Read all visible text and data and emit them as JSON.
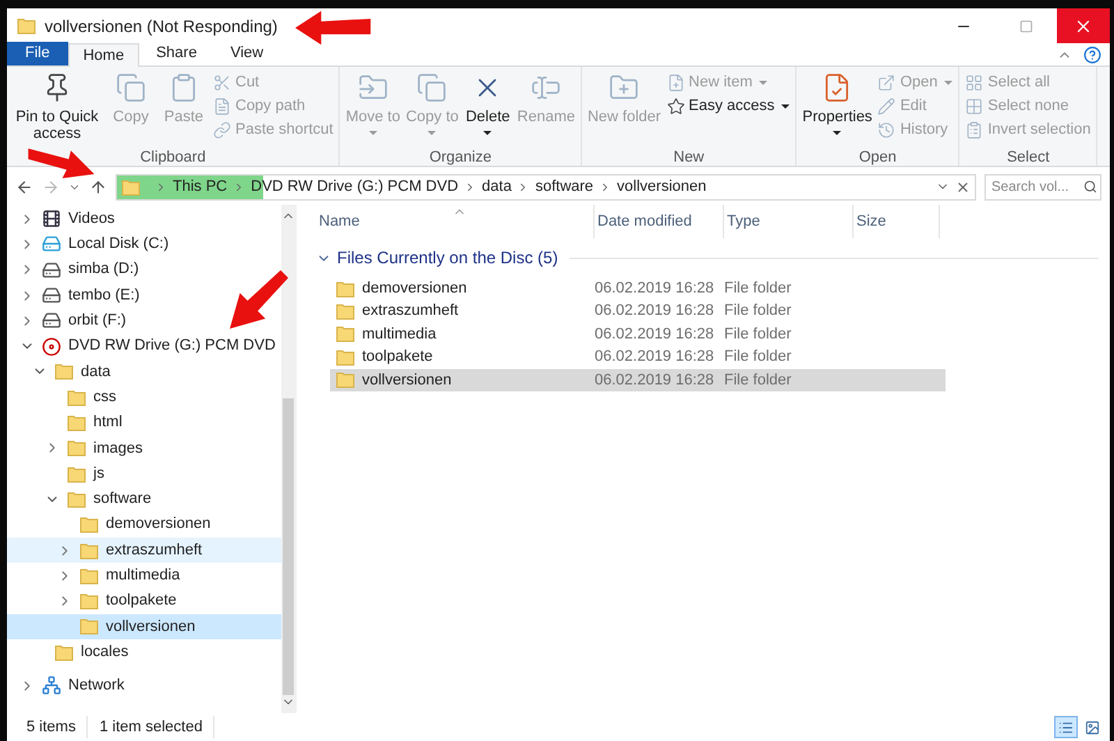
{
  "window": {
    "title": "vollversionen (Not Responding)"
  },
  "tabs": [
    {
      "label": "File",
      "kind": "file",
      "selected": false
    },
    {
      "label": "Home",
      "kind": "tab",
      "selected": true
    },
    {
      "label": "Share",
      "kind": "tab",
      "selected": false
    },
    {
      "label": "View",
      "kind": "tab",
      "selected": false
    }
  ],
  "ribbon": [
    {
      "label": "Clipboard",
      "large": [
        {
          "label": "Pin to Quick access",
          "kind": "pin",
          "disabled": false
        },
        {
          "label": "Copy",
          "kind": "copy",
          "disabled": true
        },
        {
          "label": "Paste",
          "kind": "paste",
          "disabled": true
        }
      ],
      "small": [
        {
          "label": "Cut",
          "kind": "cut",
          "disabled": true
        },
        {
          "label": "Copy path",
          "kind": "path",
          "disabled": true
        },
        {
          "label": "Paste shortcut",
          "kind": "shortcut",
          "disabled": true
        }
      ]
    },
    {
      "label": "Organize",
      "large": [
        {
          "label": "Move to",
          "kind": "move",
          "disabled": true,
          "dropdown": true
        },
        {
          "label": "Copy to",
          "kind": "copyto",
          "disabled": true,
          "dropdown": true
        },
        {
          "label": "Delete",
          "kind": "delete",
          "disabled": false,
          "dropdown": true
        },
        {
          "label": "Rename",
          "kind": "rename",
          "disabled": true
        }
      ]
    },
    {
      "label": "New",
      "large": [
        {
          "label": "New folder",
          "kind": "newfolder",
          "disabled": true
        }
      ],
      "small": [
        {
          "label": "New item",
          "kind": "newitem",
          "disabled": true,
          "dropdown": true
        },
        {
          "label": "Easy access",
          "kind": "easy",
          "disabled": false,
          "dropdown": true
        }
      ]
    },
    {
      "label": "Open",
      "large": [
        {
          "label": "Properties",
          "kind": "properties",
          "disabled": false,
          "dropdown": true
        }
      ],
      "small": [
        {
          "label": "Open",
          "kind": "open",
          "disabled": true,
          "dropdown": true
        },
        {
          "label": "Edit",
          "kind": "edit",
          "disabled": true
        },
        {
          "label": "History",
          "kind": "history",
          "disabled": true
        }
      ]
    },
    {
      "label": "Select",
      "small": [
        {
          "label": "Select all",
          "kind": "selall",
          "disabled": true
        },
        {
          "label": "Select none",
          "kind": "selnone",
          "disabled": true
        },
        {
          "label": "Invert selection",
          "kind": "invert",
          "disabled": true
        }
      ]
    }
  ],
  "address_bar": {
    "level": 0.17,
    "crumbs": [
      "This PC",
      "DVD RW Drive (G:) PCM DVD",
      "data",
      "software",
      "vollversionen"
    ]
  },
  "search": {
    "placeholder": "Search vol..."
  },
  "nav_tree": [
    {
      "label": "Videos",
      "kind": "videos",
      "expanded": false
    },
    {
      "label": "Local Disk (C:)",
      "kind": "disk",
      "expanded": false
    },
    {
      "label": "simba (D:)",
      "kind": "drive",
      "expanded": false
    },
    {
      "label": "tembo (E:)",
      "kind": "drive",
      "expanded": false
    },
    {
      "label": "orbit (F:)",
      "kind": "drive",
      "expanded": false
    },
    {
      "label": "DVD RW Drive (G:) PCM DVD",
      "kind": "dvd",
      "expanded": true,
      "children": [
        {
          "label": "data",
          "kind": "folder",
          "expanded": true,
          "children": [
            {
              "label": "css",
              "kind": "folder"
            },
            {
              "label": "html",
              "kind": "folder"
            },
            {
              "label": "images",
              "kind": "folder",
              "expanded": false
            },
            {
              "label": "js",
              "kind": "folder"
            },
            {
              "label": "software",
              "kind": "folder",
              "expanded": true,
              "children": [
                {
                  "label": "demoversionen",
                  "kind": "folder",
                  "selected": false
                },
                {
                  "label": "extraszumheft",
                  "kind": "folder",
                  "expanded": false,
                  "hovered": true
                },
                {
                  "label": "multimedia",
                  "kind": "folder",
                  "expanded": false
                },
                {
                  "label": "toolpakete",
                  "kind": "folder",
                  "expanded": false
                },
                {
                  "label": "vollversionen",
                  "kind": "folder",
                  "selected": true
                }
              ]
            }
          ]
        },
        {
          "label": "locales",
          "kind": "folder"
        }
      ]
    },
    {
      "label": "Network",
      "kind": "network",
      "expanded": false
    }
  ],
  "table": {
    "columns": [
      "Name",
      "Date modified",
      "Type",
      "Size"
    ],
    "group": {
      "label": "Files Currently on the Disc (5)",
      "expanded": true
    },
    "rows": [
      {
        "name": "demoversionen",
        "date": "06.02.2019 16:28",
        "type": "File folder",
        "selected": false
      },
      {
        "name": "extraszumheft",
        "date": "06.02.2019 16:28",
        "type": "File folder",
        "selected": false
      },
      {
        "name": "multimedia",
        "date": "06.02.2019 16:28",
        "type": "File folder",
        "selected": false
      },
      {
        "name": "toolpakete",
        "date": "06.02.2019 16:28",
        "type": "File folder",
        "selected": false
      },
      {
        "name": "vollversionen",
        "date": "06.02.2019 16:28",
        "type": "File folder",
        "selected": true
      }
    ]
  },
  "status_bar": {
    "items": [
      "5 items",
      "1 item selected"
    ],
    "views": [
      {
        "kind": "details",
        "selected": true
      },
      {
        "kind": "large",
        "selected": false
      }
    ]
  }
}
